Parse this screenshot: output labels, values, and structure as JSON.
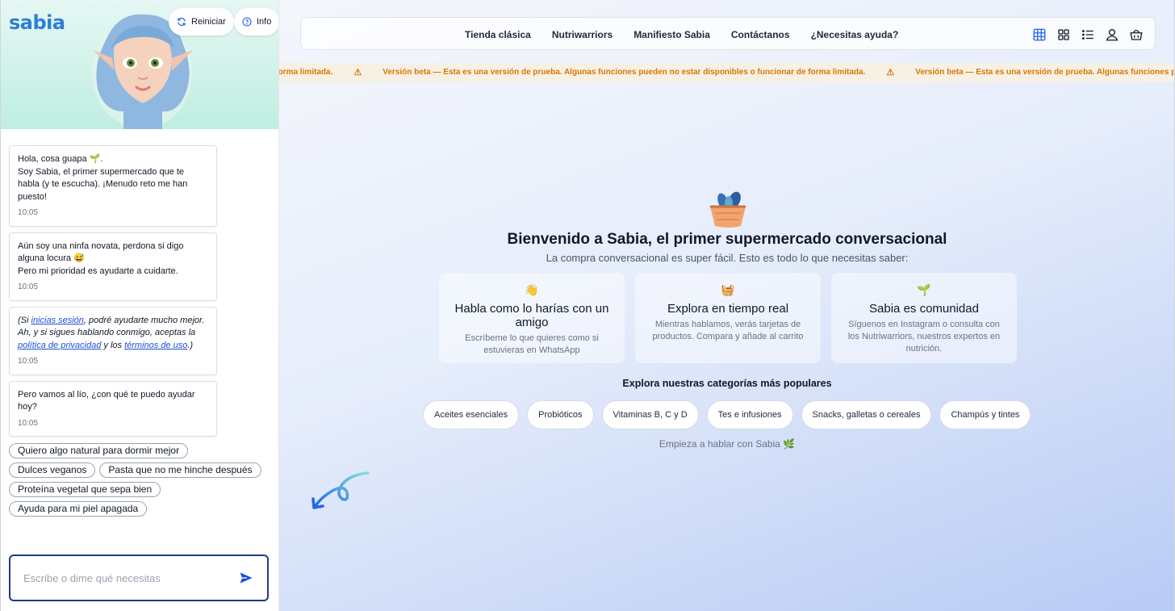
{
  "sidebar": {
    "logo": "sabia",
    "restart_label": "Reiniciar",
    "info_label": "Info",
    "messages": [
      {
        "lines": [
          "Hola, cosa guapa 🌱.",
          "Soy Sabia, el primer supermercado que te habla (y te escucha). ¡Menudo reto me han puesto!"
        ],
        "time": "10:05"
      },
      {
        "lines": [
          "Aún soy una ninfa novata, perdona si digo alguna locura 😅",
          "Pero mi prioridad es ayudarte a cuidarte."
        ],
        "time": "10:05"
      },
      {
        "legal": {
          "p1": "(Si ",
          "link1": "inicias sesión",
          "p2": ", podré ayudarte mucho mejor. Ah, y si sigues hablando conmigo, aceptas la ",
          "link2": "política de privacidad",
          "p3": " y los ",
          "link3": "términos de uso",
          "p4": ".)"
        },
        "time": "10:05"
      },
      {
        "lines": [
          "Pero vamos al lío, ¿con qué te puedo ayudar hoy?"
        ],
        "time": "10:05"
      }
    ],
    "suggestions": [
      "Quiero algo natural para dormir mejor",
      "Dulces veganos",
      "Pasta que no me hinche después",
      "Proteína vegetal que sepa bien",
      "Ayuda para mi piel apagada"
    ],
    "input_placeholder": "Escribe o dime qué necesitas",
    "input_value": ""
  },
  "navbar": {
    "links": [
      "Tienda clásica",
      "Nutriwarriors",
      "Manifiesto Sabia",
      "Contáctanos",
      "¿Necesitas ayuda?"
    ],
    "icons": [
      "grid-view-icon",
      "tiles-view-icon",
      "list-view-icon",
      "user-icon",
      "basket-icon"
    ],
    "accent": "#2563eb"
  },
  "banner": {
    "text_tail": "cionar de forma limitada.",
    "text": "Versión beta — Esta es una versión de prueba. Algunas funciones pueden no estar disponibles o funcionar de forma limitada.",
    "text_head": "Versión beta — Esta es una versión de prueba. Algunas funciones pueden no est",
    "color": "#d97706"
  },
  "welcome": {
    "title": "Bienvenido a Sabia, el primer supermercado conversacional",
    "subtitle": "La compra conversacional es super fácil. Esto es todo lo que necesitas saber:",
    "cards": [
      {
        "icon": "👋",
        "title": "Habla como lo harías con un amigo",
        "desc": "Escríbeme lo que quieres como si estuvieras en WhatsApp"
      },
      {
        "icon": "🧺",
        "title": "Explora en tiempo real",
        "desc": "Mientras hablamos, verás tarjetas de productos. Compara y añade al carrito"
      },
      {
        "icon": "🌱",
        "title": "Sabia es comunidad",
        "desc": "Síguenos en Instagram o consulta con los Nutriwarriors, nuestros expertos en nutrición."
      }
    ],
    "categories_title": "Explora nuestras categorías más populares",
    "categories": [
      "Aceites esenciales",
      "Probióticos",
      "Vitaminas B, C y D",
      "Tes e infusiones",
      "Snacks, galletas o cereales",
      "Champús y tintes"
    ],
    "hint": "Empieza a hablar con Sabia 🌿"
  }
}
